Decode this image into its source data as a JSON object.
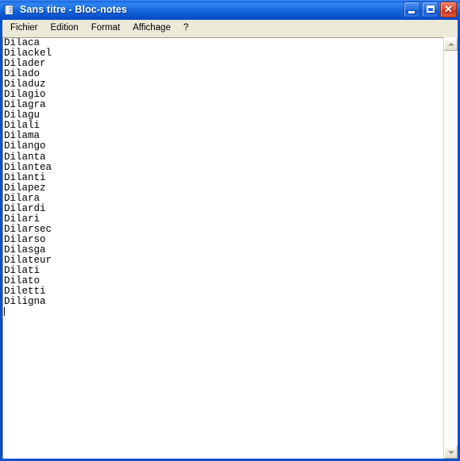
{
  "window": {
    "title": "Sans titre - Bloc-notes",
    "icon": "notepad-icon",
    "colors": {
      "titlebar_blue": "#0A5BD3",
      "menubar_beige": "#ECE9D8",
      "close_red": "#C9341A",
      "client_white": "#FFFFFF"
    }
  },
  "titlebar_buttons": {
    "minimize": "–",
    "maximize": "□",
    "close": "✕"
  },
  "menubar": {
    "items": [
      {
        "label": "Fichier"
      },
      {
        "label": "Edition"
      },
      {
        "label": "Format"
      },
      {
        "label": "Affichage"
      },
      {
        "label": "?"
      }
    ]
  },
  "editor": {
    "lines": [
      "Dilaca",
      "Dilackel",
      "Dilader",
      "Dilado",
      "Diladuz",
      "Dilagio",
      "Dilagra",
      "Dilagu",
      "Dilali",
      "Dilama",
      "Dilango",
      "Dilanta",
      "Dilantea",
      "Dilanti",
      "Dilapez",
      "Dilara",
      "Dilardi",
      "Dilari",
      "Dilarsec",
      "Dilarso",
      "Dilasga",
      "Dilateur",
      "Dilati",
      "Dilato",
      "Diletti",
      "Diligna"
    ],
    "caret_line": 26,
    "caret_visible": true
  },
  "scrollbar": {
    "up_arrow": "scroll-up-arrow-icon",
    "down_arrow": "scroll-down-arrow-icon",
    "thumb_visible": false
  }
}
